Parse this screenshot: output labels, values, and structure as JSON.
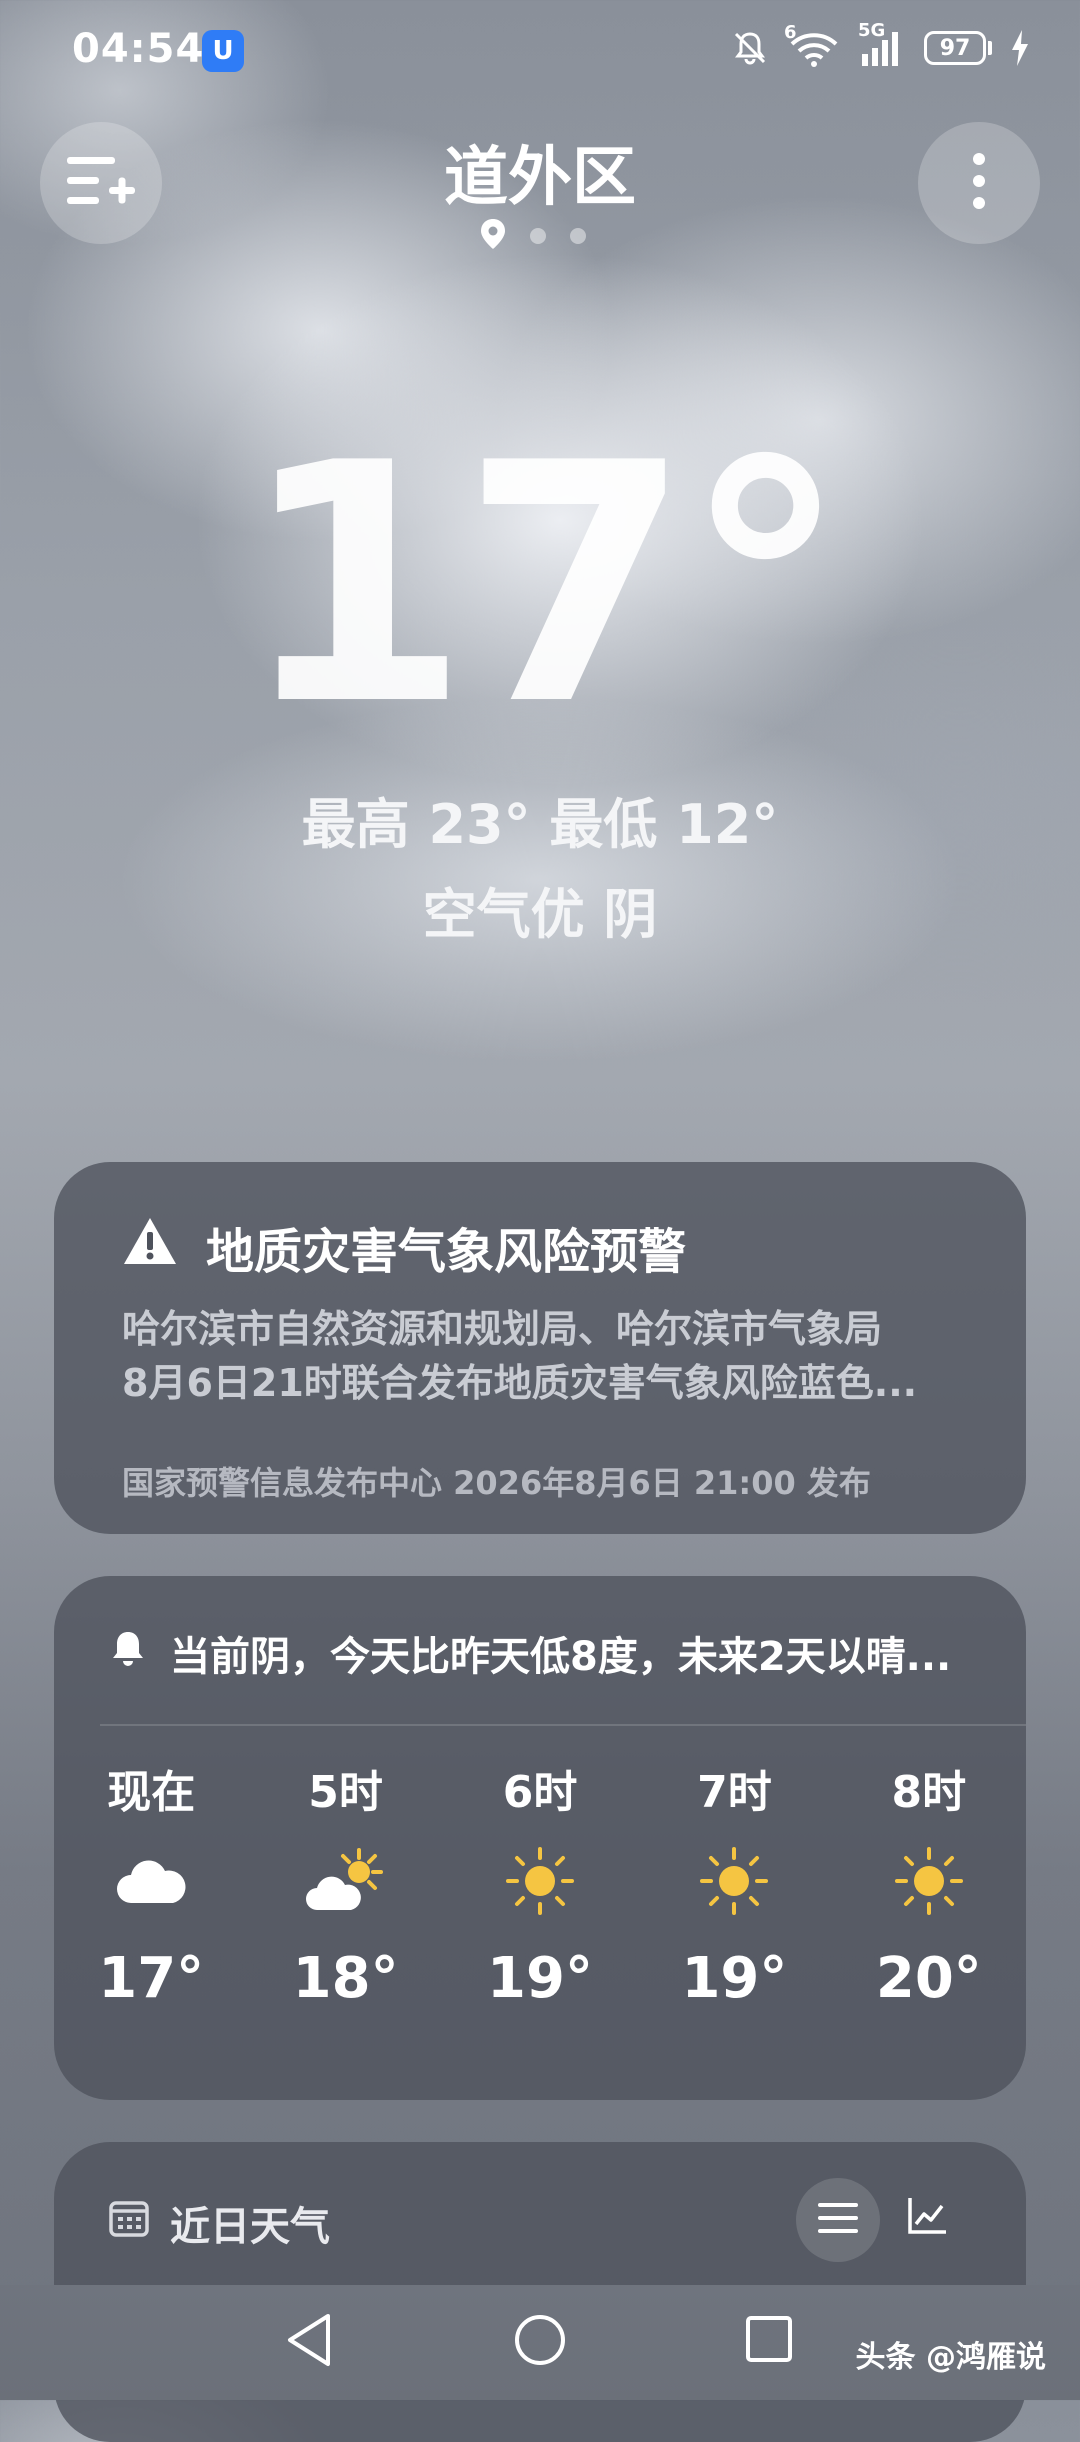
{
  "status_bar": {
    "time": "04:54",
    "app_badge": "U",
    "wifi_label": "6",
    "signal_label": "5G",
    "battery": "97"
  },
  "header": {
    "city": "道外区",
    "page_count": 3,
    "active_page": 1
  },
  "current": {
    "temperature": "17°",
    "high_low": "最高 23° 最低 12°",
    "air_condition": "空气优  阴"
  },
  "alert": {
    "title": "地质灾害气象风险预警",
    "body_line1": "哈尔滨市自然资源和规划局、哈尔滨市气象局",
    "body_line2": "8月6日21时联合发布地质灾害气象风险蓝色...",
    "source": "国家预警信息发布中心 2026年8月6日 21:00 发布"
  },
  "hourly": {
    "summary": "当前阴，今天比昨天低8度，未来2天以晴...",
    "items": [
      {
        "label": "现在",
        "icon": "cloud-icon",
        "temp": "17°"
      },
      {
        "label": "5时",
        "icon": "partly-sunny-icon",
        "temp": "18°"
      },
      {
        "label": "6时",
        "icon": "sun-icon",
        "temp": "19°"
      },
      {
        "label": "7时",
        "icon": "sun-icon",
        "temp": "19°"
      },
      {
        "label": "8时",
        "icon": "sun-icon",
        "temp": "20°"
      }
    ]
  },
  "recent": {
    "title": "近日天气"
  },
  "watermark": "头条 @鸿雁说",
  "colors": {
    "card": "#4e525c",
    "sun": "#f5c542",
    "app_badge": "#2f7cf6"
  }
}
